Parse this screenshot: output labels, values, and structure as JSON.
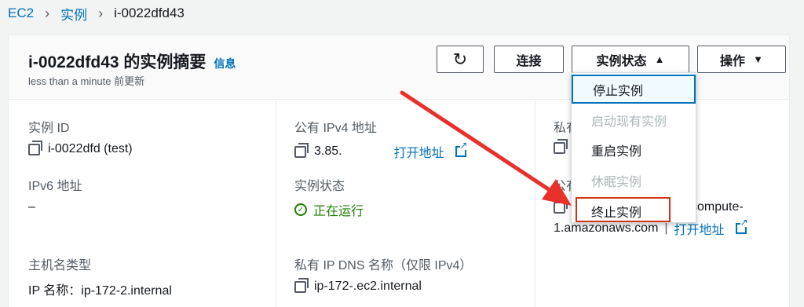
{
  "breadcrumb": {
    "root": "EC2",
    "section": "实例",
    "current": "i-0022dfd43"
  },
  "header": {
    "title": "i-0022dfd43 的实例摘要",
    "info": "信息",
    "subtitle": "less than a minute 前更新",
    "refresh_icon": "↻",
    "connect_label": "连接",
    "state_label": "实例状态",
    "state_caret": "▲",
    "actions_label": "操作",
    "actions_caret": "▼"
  },
  "details": {
    "instance_id": {
      "label": "实例 ID",
      "value": "i-0022dfd (test)"
    },
    "public_ipv4": {
      "label": "公有 IPv4 地址",
      "value": "3.85.",
      "open_link": "打开地址"
    },
    "private_partial": {
      "label": "私有"
    },
    "ipv6": {
      "label": "IPv6 地址",
      "value": "–"
    },
    "instance_state": {
      "label": "实例状态",
      "value": "正在运行"
    },
    "public_dns_partial": {
      "label": "公有",
      "value_tail": "compute-",
      "value_line2": "1.amazonaws.com",
      "open_link": "打开地址"
    },
    "hostname_type": {
      "label": "主机名类型",
      "value": "IP 名称：ip-172-2.internal"
    },
    "private_dns": {
      "label": "私有 IP DNS 名称（仅限 IPv4）",
      "value": "ip-172-.ec2.internal"
    }
  },
  "state_menu": {
    "items": [
      {
        "label": "停止实例",
        "state": "focused"
      },
      {
        "label": "启动现有实例",
        "state": "disabled"
      },
      {
        "label": "重启实例",
        "state": "enabled"
      },
      {
        "label": "休眠实例",
        "state": "disabled"
      },
      {
        "label": "终止实例",
        "state": "highlighted"
      }
    ]
  },
  "colors": {
    "link": "#0073bb",
    "running": "#1d8102",
    "annotation_red": "#d13212",
    "arrow_red": "#e8312a"
  }
}
